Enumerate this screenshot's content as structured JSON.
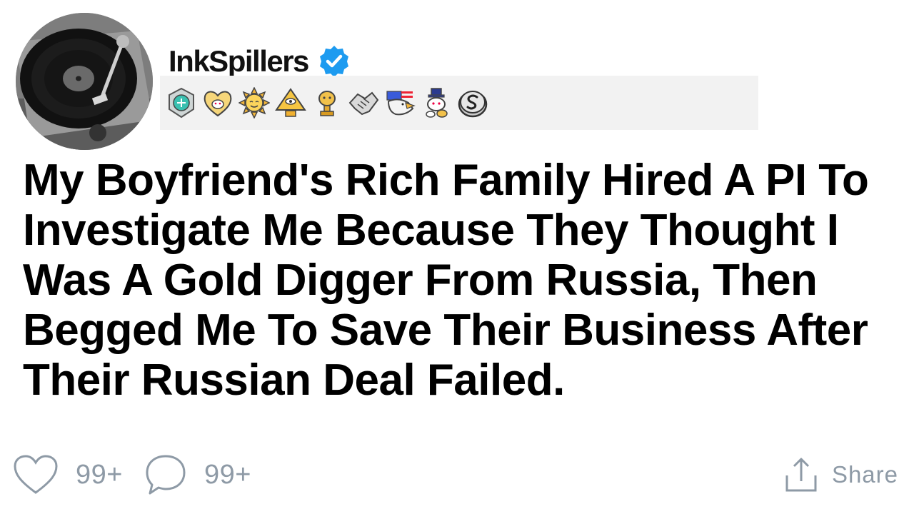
{
  "author": {
    "username": "InkSpillers",
    "verified": true,
    "verified_color": "#1d9bf0",
    "avatar_icon": "turntable-icon"
  },
  "awards": [
    {
      "icon": "silver-gem-award-icon"
    },
    {
      "icon": "heart-snoo-award-icon"
    },
    {
      "icon": "sun-face-award-icon"
    },
    {
      "icon": "illuminati-pyramid-award-icon"
    },
    {
      "icon": "gold-trophy-snoo-award-icon"
    },
    {
      "icon": "handshake-award-icon"
    },
    {
      "icon": "patriot-eagle-award-icon"
    },
    {
      "icon": "snoo-top-hat-award-icon"
    },
    {
      "icon": "silver-s-coin-award-icon"
    }
  ],
  "post": {
    "title": "My Boyfriend's Rich Family Hired A PI To Investigate Me Because They Thought I Was A Gold Digger From Russia, Then Begged Me To Save Their Business After Their Russian Deal Failed."
  },
  "footer": {
    "likes": "99+",
    "comments": "99+",
    "share_label": "Share",
    "icon_color": "#8e9aa6"
  }
}
